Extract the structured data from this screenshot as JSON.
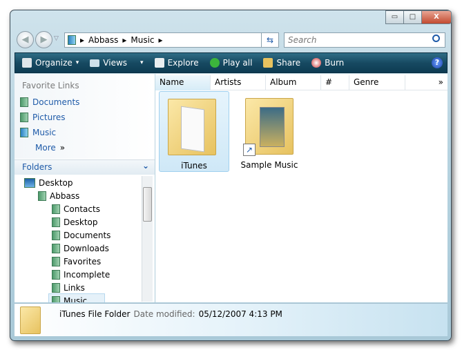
{
  "window": {
    "minimize": "▭",
    "maximize": "□",
    "close": "X"
  },
  "nav": {
    "back": "◀",
    "forward": "▶",
    "recent": "▽"
  },
  "address": {
    "crumbs": [
      "Abbass",
      "Music"
    ],
    "separator": "▸",
    "dropdown": "▾",
    "refresh": "⇆"
  },
  "search": {
    "placeholder": "Search",
    "icon": "search-icon"
  },
  "toolbar": {
    "items": [
      {
        "label": "Organize",
        "arrow": "▾"
      },
      {
        "label": "Views",
        "arrow": "▾"
      },
      {
        "label": "Explore"
      },
      {
        "label": "Play all"
      },
      {
        "label": "Share"
      },
      {
        "label": "Burn"
      }
    ],
    "help": "?"
  },
  "favorites": {
    "title": "Favorite Links",
    "items": [
      "Documents",
      "Pictures",
      "Music"
    ],
    "more": "More",
    "more_arrow": "»"
  },
  "folders": {
    "title": "Folders",
    "chevron": "⌄",
    "tree": [
      {
        "label": "Desktop",
        "level": 0
      },
      {
        "label": "Abbass",
        "level": 1
      },
      {
        "label": "Contacts",
        "level": 2
      },
      {
        "label": "Desktop",
        "level": 2
      },
      {
        "label": "Documents",
        "level": 2
      },
      {
        "label": "Downloads",
        "level": 2
      },
      {
        "label": "Favorites",
        "level": 2
      },
      {
        "label": "Incomplete",
        "level": 2
      },
      {
        "label": "Links",
        "level": 2
      },
      {
        "label": "Music",
        "level": 2,
        "selected": true
      }
    ]
  },
  "columns": [
    "Name",
    "Artists",
    "Album",
    "#",
    "Genre"
  ],
  "columns_more": "»",
  "files": [
    {
      "name": "iTunes",
      "selected": true
    },
    {
      "name": "Sample Music",
      "shortcut": true
    }
  ],
  "details": {
    "name": "iTunes File Folder",
    "date_label": "Date modified:",
    "date_value": "05/12/2007 4:13 PM"
  }
}
